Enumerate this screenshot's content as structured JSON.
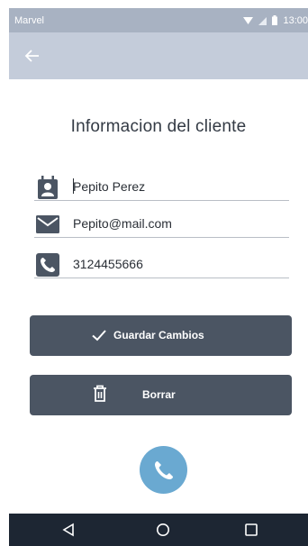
{
  "status_bar": {
    "carrier": "Marvel",
    "time": "13:00"
  },
  "app_bar": {
    "back_icon": "arrow-left-icon"
  },
  "page_title": "Informacion del cliente",
  "form": {
    "name": {
      "icon": "contact-card-icon",
      "value": "Pepito Perez"
    },
    "email": {
      "icon": "mail-icon",
      "value": "Pepito@mail.com"
    },
    "phone": {
      "icon": "phone-icon",
      "value": "3124455666"
    }
  },
  "actions": {
    "save": {
      "label": "Guardar Cambios",
      "icon": "check-icon"
    },
    "delete": {
      "label": "Borrar",
      "icon": "trash-icon"
    }
  },
  "fab": {
    "icon": "phone-icon"
  },
  "nav_bar": {
    "back": "nav-back-icon",
    "home": "nav-home-icon",
    "recents": "nav-recents-icon"
  },
  "colors": {
    "status_bar": "#a8b2c2",
    "app_bar": "#c4ccda",
    "button": "#4b5563",
    "fab": "#6aa9d1",
    "nav_bar": "#1d2633"
  }
}
